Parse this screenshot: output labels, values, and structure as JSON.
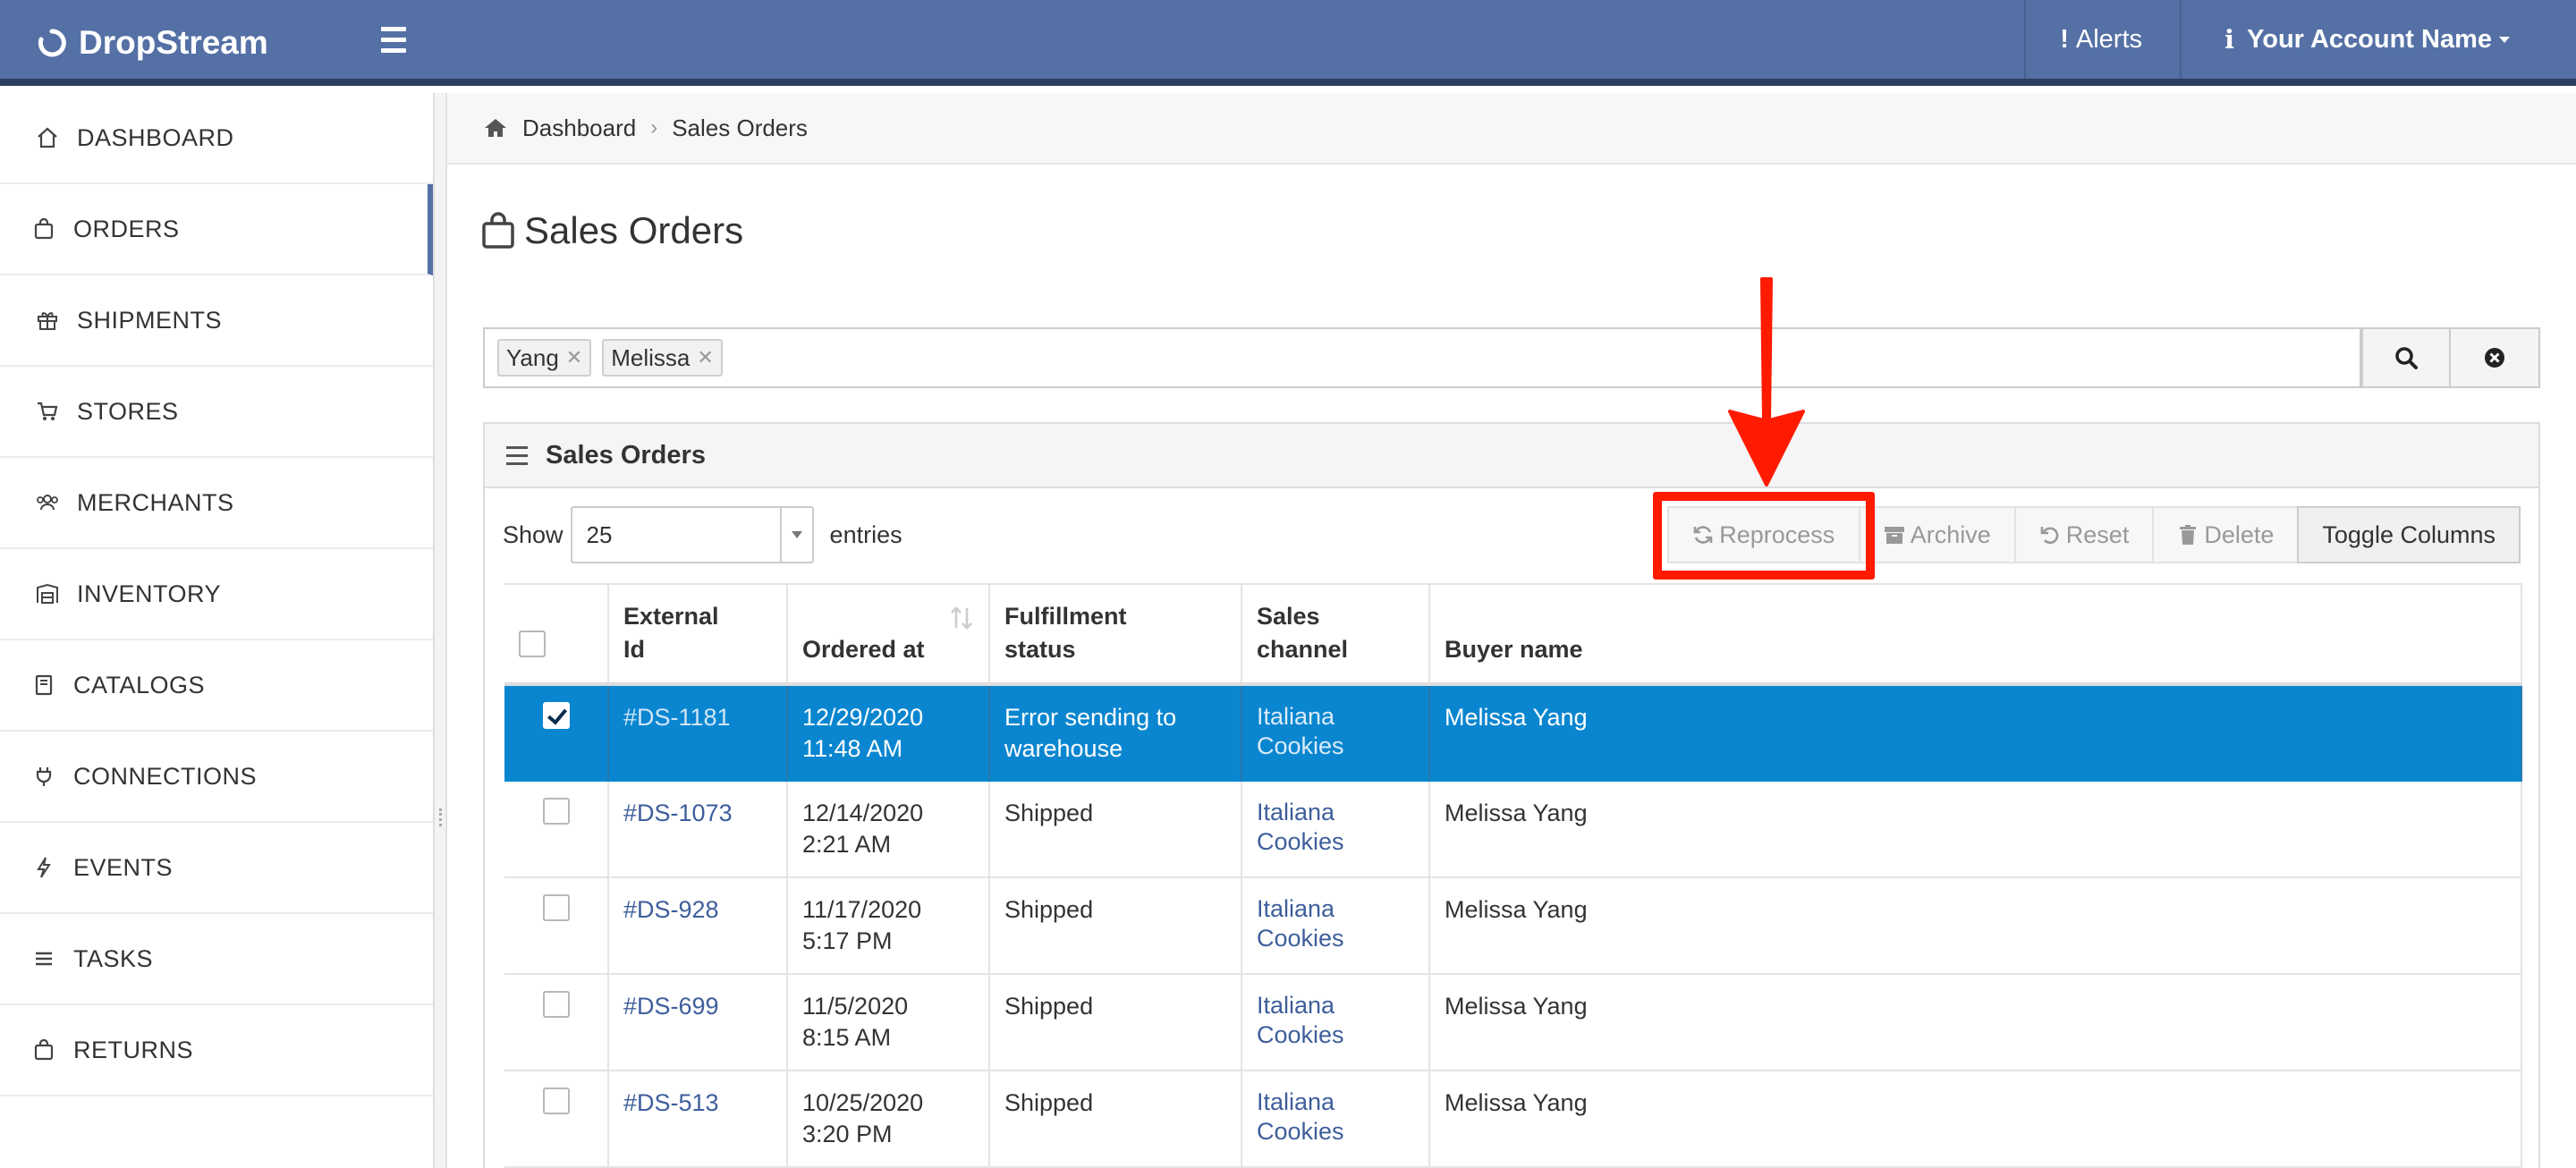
{
  "app": {
    "brand": "DropStream",
    "alerts_label": "Alerts",
    "account_label": "Your Account Name"
  },
  "sidebar": {
    "items": [
      {
        "label": "DASHBOARD",
        "icon": "home-icon"
      },
      {
        "label": "ORDERS",
        "icon": "shopping-bag-icon",
        "active": true
      },
      {
        "label": "SHIPMENTS",
        "icon": "gift-icon"
      },
      {
        "label": "STORES",
        "icon": "cart-icon"
      },
      {
        "label": "MERCHANTS",
        "icon": "users-icon"
      },
      {
        "label": "INVENTORY",
        "icon": "warehouse-icon"
      },
      {
        "label": "CATALOGS",
        "icon": "book-icon"
      },
      {
        "label": "CONNECTIONS",
        "icon": "plug-icon"
      },
      {
        "label": "EVENTS",
        "icon": "bolt-icon"
      },
      {
        "label": "TASKS",
        "icon": "list-icon"
      },
      {
        "label": "RETURNS",
        "icon": "shopping-bag-icon"
      }
    ]
  },
  "breadcrumb": {
    "home": "Dashboard",
    "current": "Sales Orders"
  },
  "page": {
    "title": "Sales Orders"
  },
  "search": {
    "tags": [
      "Yang",
      "Melissa"
    ]
  },
  "panel": {
    "title": "Sales Orders",
    "show_label": "Show",
    "entries_value": "25",
    "entries_label": "entries",
    "buttons": {
      "reprocess": "Reprocess",
      "archive": "Archive",
      "reset": "Reset",
      "delete": "Delete",
      "toggle_columns": "Toggle Columns"
    }
  },
  "table": {
    "headers": {
      "external_id_1": "External",
      "external_id_2": "Id",
      "ordered_at": "Ordered at",
      "fulfillment_1": "Fulfillment",
      "fulfillment_2": "status",
      "channel_1": "Sales",
      "channel_2": "channel",
      "buyer": "Buyer name"
    },
    "rows": [
      {
        "id": "#DS-1181",
        "date": "12/29/2020",
        "time": "11:48 AM",
        "status_1": "Error sending to",
        "status_2": "warehouse",
        "channel_1": "Italiana",
        "channel_2": "Cookies",
        "buyer": "Melissa Yang",
        "selected": true
      },
      {
        "id": "#DS-1073",
        "date": "12/14/2020",
        "time": "2:21 AM",
        "status_1": "Shipped",
        "status_2": "",
        "channel_1": "Italiana",
        "channel_2": "Cookies",
        "buyer": "Melissa Yang",
        "selected": false
      },
      {
        "id": "#DS-928",
        "date": "11/17/2020",
        "time": "5:17 PM",
        "status_1": "Shipped",
        "status_2": "",
        "channel_1": "Italiana",
        "channel_2": "Cookies",
        "buyer": "Melissa Yang",
        "selected": false
      },
      {
        "id": "#DS-699",
        "date": "11/5/2020",
        "time": "8:15 AM",
        "status_1": "Shipped",
        "status_2": "",
        "channel_1": "Italiana",
        "channel_2": "Cookies",
        "buyer": "Melissa Yang",
        "selected": false
      },
      {
        "id": "#DS-513",
        "date": "10/25/2020",
        "time": "3:20 PM",
        "status_1": "Shipped",
        "status_2": "",
        "channel_1": "Italiana",
        "channel_2": "Cookies",
        "buyer": "Melissa Yang",
        "selected": false
      }
    ]
  },
  "colors": {
    "navbar": "#5470a5",
    "selected_row": "#0a86d0",
    "link": "#3e5e9c",
    "annotation": "#ff1a00"
  }
}
